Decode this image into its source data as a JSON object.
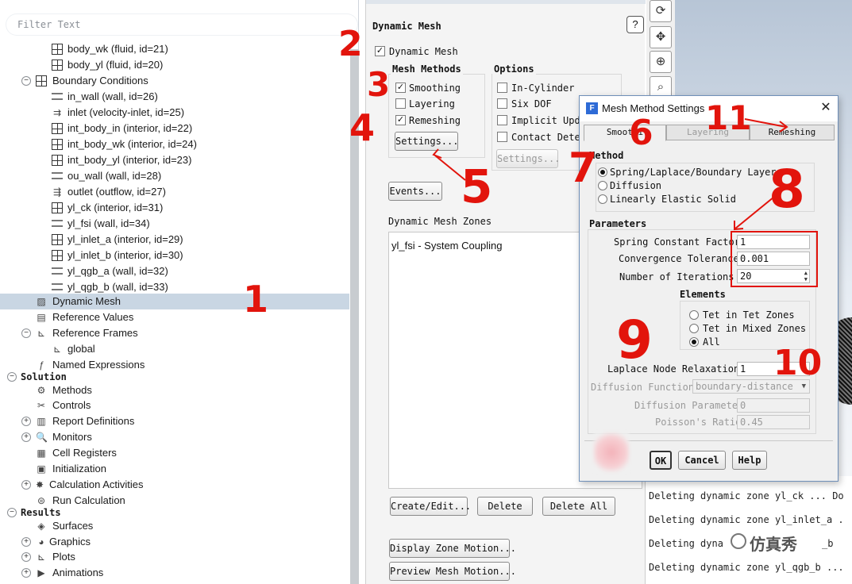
{
  "tree": {
    "filter_placeholder": "Filter Text",
    "rows": [
      {
        "label": "body_wk (fluid, id=21)",
        "icon": "grid-icon"
      },
      {
        "label": "body_yl (fluid, id=20)",
        "icon": "grid-icon"
      },
      {
        "label": "Boundary Conditions",
        "icon": "boundary-conditions-icon"
      },
      {
        "label": "in_wall (wall, id=26)",
        "icon": "wall-icon"
      },
      {
        "label": "inlet (velocity-inlet, id=25)",
        "icon": "inlet-icon"
      },
      {
        "label": "int_body_in (interior, id=22)",
        "icon": "grid-icon"
      },
      {
        "label": "int_body_wk (interior, id=24)",
        "icon": "grid-icon"
      },
      {
        "label": "int_body_yl (interior, id=23)",
        "icon": "grid-icon"
      },
      {
        "label": "ou_wall (wall, id=28)",
        "icon": "wall-icon"
      },
      {
        "label": "outlet (outflow, id=27)",
        "icon": "outlet-icon"
      },
      {
        "label": "yl_ck (interior, id=31)",
        "icon": "grid-icon"
      },
      {
        "label": "yl_fsi (wall, id=34)",
        "icon": "wall-icon"
      },
      {
        "label": "yl_inlet_a (interior, id=29)",
        "icon": "grid-icon"
      },
      {
        "label": "yl_inlet_b (interior, id=30)",
        "icon": "grid-icon"
      },
      {
        "label": "yl_qgb_a (wall, id=32)",
        "icon": "wall-icon"
      },
      {
        "label": "yl_qgb_b (wall, id=33)",
        "icon": "wall-icon"
      },
      {
        "label": "Dynamic Mesh",
        "icon": "dynamic-mesh-icon"
      },
      {
        "label": "Reference Values",
        "icon": "reference-values-icon"
      },
      {
        "label": "Reference Frames",
        "icon": "reference-frames-icon"
      },
      {
        "label": "global",
        "icon": "axes-icon"
      },
      {
        "label": "Named Expressions",
        "icon": "function-icon"
      },
      {
        "label": "Solution",
        "icon": ""
      },
      {
        "label": "Methods",
        "icon": "methods-icon"
      },
      {
        "label": "Controls",
        "icon": "controls-icon"
      },
      {
        "label": "Report Definitions",
        "icon": "report-icon"
      },
      {
        "label": "Monitors",
        "icon": "monitors-icon"
      },
      {
        "label": "Cell Registers",
        "icon": "cell-registers-icon"
      },
      {
        "label": "Initialization",
        "icon": "initialization-icon"
      },
      {
        "label": "Calculation Activities",
        "icon": "gear-icon"
      },
      {
        "label": "Run Calculation",
        "icon": "run-icon"
      },
      {
        "label": "Results",
        "icon": ""
      },
      {
        "label": "Surfaces",
        "icon": "surfaces-icon"
      },
      {
        "label": "Graphics",
        "icon": "graphics-icon"
      },
      {
        "label": "Plots",
        "icon": "plots-icon"
      },
      {
        "label": "Animations",
        "icon": "animations-icon"
      }
    ]
  },
  "mesh_panel": {
    "title": "Dynamic Mesh",
    "help": "?",
    "dynamic_mesh_check": "Dynamic Mesh",
    "mesh_methods_title": "Mesh Methods",
    "smoothing": "Smoothing",
    "layering": "Layering",
    "remeshing": "Remeshing",
    "settings_btn": "Settings...",
    "options_title": "Options",
    "in_cylinder": "In-Cylinder",
    "six_dof": "Six DOF",
    "implicit_update": "Implicit Upda",
    "contact_detection": "Contact Detec",
    "options_settings_btn": "Settings...",
    "events_btn": "Events...",
    "zones_title": "Dynamic Mesh Zones",
    "zones": [
      "yl_fsi - System Coupling"
    ],
    "create_edit_btn": "Create/Edit...",
    "delete_btn": "Delete",
    "delete_all_btn": "Delete All",
    "display_zone_motion_btn": "Display Zone Motion...",
    "preview_mesh_motion_btn": "Preview Mesh Motion..."
  },
  "console": {
    "first_line_tail": "Do",
    "lines": [
      "Deleting dynamic zone yl_ck ... Do",
      "Deleting dynamic zone yl_inlet_a .",
      "Deleting dyna",
      "Deleting dynamic zone yl_qgb_b ..."
    ],
    "overlay_tail": "_b"
  },
  "toolbar": [
    "rotate-icon",
    "pan-icon",
    "zoom-icon",
    "zoom-box-icon"
  ],
  "dialog": {
    "title": "Mesh Method Settings",
    "close": "✕",
    "tabs": [
      "Smoothi",
      "Layering",
      "Remeshing"
    ],
    "method_title": "Method",
    "methods": [
      "Spring/Laplace/Boundary Layer",
      "Diffusion",
      "Linearly Elastic Solid"
    ],
    "method_selected": 0,
    "parameters_title": "Parameters",
    "spring_constant_label": "Spring Constant Factor",
    "spring_constant_value": "1",
    "convergence_label": "Convergence Tolerance",
    "convergence_value": "0.001",
    "iterations_label": "Number of Iterations",
    "iterations_value": "20",
    "elements_title": "Elements",
    "elements": [
      "Tet in Tet Zones",
      "Tet in Mixed Zones",
      "All"
    ],
    "elements_selected": 2,
    "laplace_label": "Laplace Node Relaxation",
    "laplace_value": "1",
    "diffusion_function_label": "Diffusion Function",
    "diffusion_function_value": "boundary-distance",
    "diffusion_parameter_label": "Diffusion Parameter",
    "diffusion_parameter_value": "0",
    "poisson_label": "Poisson's Ratio",
    "poisson_value": "0.45",
    "ok": "OK",
    "cancel": "Cancel",
    "help": "Help"
  },
  "annotations": {
    "n1": "1",
    "n2": "2",
    "n3": "3",
    "n4": "4",
    "n5": "5",
    "n6": "6",
    "n7": "7",
    "n8": "8",
    "n9": "9",
    "n10": "10",
    "n11": "11"
  },
  "watermark": "仿真秀",
  "colors": {
    "annotation": "#e2140c",
    "selection": "#c9d6e3",
    "dialog_border": "#6f8fb8"
  }
}
